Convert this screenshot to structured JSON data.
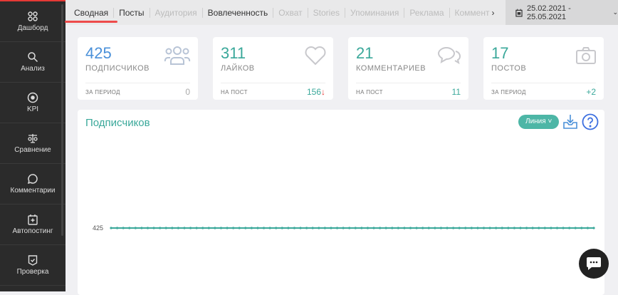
{
  "sidebar": {
    "items": [
      {
        "label": "Дашборд",
        "icon": "dashboard-icon"
      },
      {
        "label": "Анализ",
        "icon": "search-icon"
      },
      {
        "label": "KPI",
        "icon": "target-icon"
      },
      {
        "label": "Сравнение",
        "icon": "scales-icon"
      },
      {
        "label": "Комментарии",
        "icon": "comment-icon"
      },
      {
        "label": "Автопостинг",
        "icon": "calendar-plus-icon"
      },
      {
        "label": "Проверка",
        "icon": "check-shield-icon"
      }
    ]
  },
  "tabs": [
    {
      "label": "Сводная",
      "state": "active"
    },
    {
      "label": "Посты"
    },
    {
      "label": "Аудитория",
      "state": "disabled"
    },
    {
      "label": "Вовлеченность"
    },
    {
      "label": "Охват",
      "state": "disabled"
    },
    {
      "label": "Stories",
      "state": "disabled"
    },
    {
      "label": "Упоминания",
      "state": "disabled"
    },
    {
      "label": "Реклама",
      "state": "disabled"
    },
    {
      "label": "Коммент",
      "state": "disabled"
    }
  ],
  "date_range": "25.02.2021 - 25.05.2021",
  "cards": [
    {
      "value": "425",
      "label": "ПОДПИСЧИКОВ",
      "foot_label": "ЗА ПЕРИОД",
      "foot_value": "0",
      "color": "#4a90d9"
    },
    {
      "value": "311",
      "label": "ЛАЙКОВ",
      "foot_label": "НА ПОСТ",
      "foot_value": "156",
      "trend": "↓",
      "color": "#3aa89a"
    },
    {
      "value": "21",
      "label": "КОММЕНТАРИЕВ",
      "foot_label": "НА ПОСТ",
      "foot_value": "11",
      "color": "#3aa89a"
    },
    {
      "value": "17",
      "label": "ПОСТОВ",
      "foot_label": "ЗА ПЕРИОД",
      "foot_value": "+2",
      "color": "#3aa89a"
    }
  ],
  "panel": {
    "title": "Подписчиков",
    "chart_type_label": "Линия"
  },
  "chart_data": {
    "type": "line",
    "title": "Подписчиков",
    "y_tick_labels": [
      "425"
    ],
    "series": [
      {
        "name": "Подписчиков",
        "values": [
          425,
          425,
          425,
          425,
          425,
          425,
          425,
          425,
          425,
          425,
          425,
          425,
          425,
          425,
          425,
          425,
          425,
          425,
          425,
          425,
          425,
          425,
          425,
          425,
          425,
          425,
          425,
          425,
          425,
          425,
          425,
          425,
          425,
          425,
          425,
          425,
          425,
          425,
          425,
          425,
          425,
          425,
          425,
          425,
          425,
          425,
          425,
          425,
          425,
          425,
          425,
          425,
          425,
          425,
          425,
          425,
          425,
          425,
          425,
          425,
          425,
          425,
          425,
          425,
          425,
          425,
          425,
          425,
          425,
          425,
          425,
          425,
          425,
          425,
          425,
          425,
          425,
          425,
          425,
          425
        ]
      }
    ],
    "color": "#3aa89a"
  }
}
